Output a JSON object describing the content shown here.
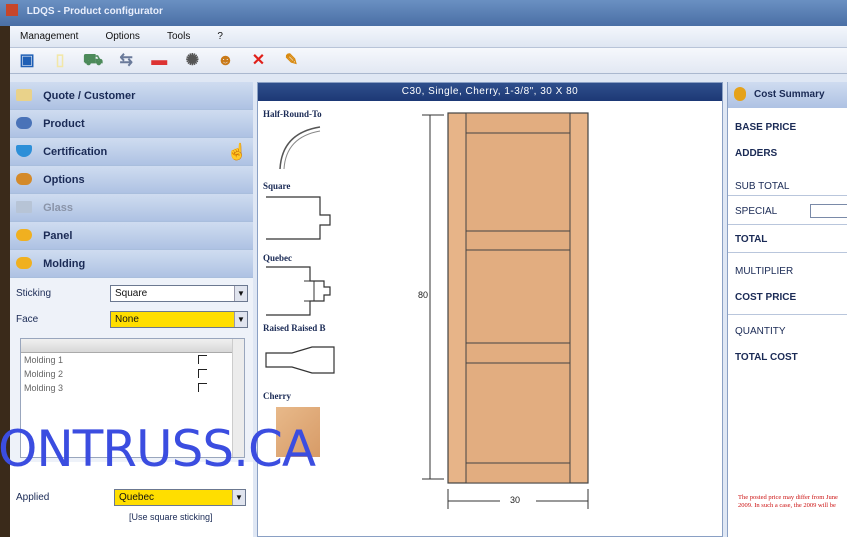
{
  "window": {
    "title": "LDQS - Product configurator"
  },
  "menu": [
    "Management",
    "Options",
    "Tools",
    "?"
  ],
  "toolbar_icons": [
    "save-icon",
    "new-icon",
    "cart-icon",
    "link-icon",
    "delete-icon",
    "settings-icon",
    "user-icon",
    "close-icon",
    "tools-icon"
  ],
  "sidebar": {
    "sections": [
      {
        "label": "Quote / Customer",
        "icon": "folder-icon"
      },
      {
        "label": "Product",
        "icon": "product-icon"
      },
      {
        "label": "Certification",
        "icon": "shield-icon"
      },
      {
        "label": "Options",
        "icon": "options-icon"
      },
      {
        "label": "Glass",
        "icon": "glass-icon"
      },
      {
        "label": "Panel",
        "icon": "panel-icon"
      },
      {
        "label": "Molding",
        "icon": "molding-icon"
      }
    ],
    "sticking": {
      "label": "Sticking",
      "value": "Square"
    },
    "face": {
      "label": "Face",
      "value": "None"
    },
    "moldings": [
      "Molding 1",
      "Molding 2",
      "Molding 3"
    ],
    "applied": {
      "label": "Applied",
      "value": "Quebec",
      "note": "[Use square sticking]"
    }
  },
  "preview": {
    "header": "C30,  Single,  Cherry,  1-3/8\",  30 X 80",
    "profiles": [
      "Half-Round-To",
      "Square",
      "Quebec",
      "Raised Raised B",
      "Cherry"
    ],
    "height_label": "80",
    "width_label": "30"
  },
  "cost": {
    "title": "Cost Summary",
    "base_price": "BASE PRICE",
    "adders": "ADDERS",
    "sub_total": "SUB TOTAL",
    "special": "SPECIAL",
    "total": "TOTAL",
    "multiplier": "MULTIPLIER",
    "cost_price": "COST PRICE",
    "quantity": "QUANTITY",
    "total_cost": "TOTAL COST",
    "notice": "The posted price may differ from June 2009. In such a case, the 2009 will be"
  },
  "watermark": "ONTRUSS.CA"
}
